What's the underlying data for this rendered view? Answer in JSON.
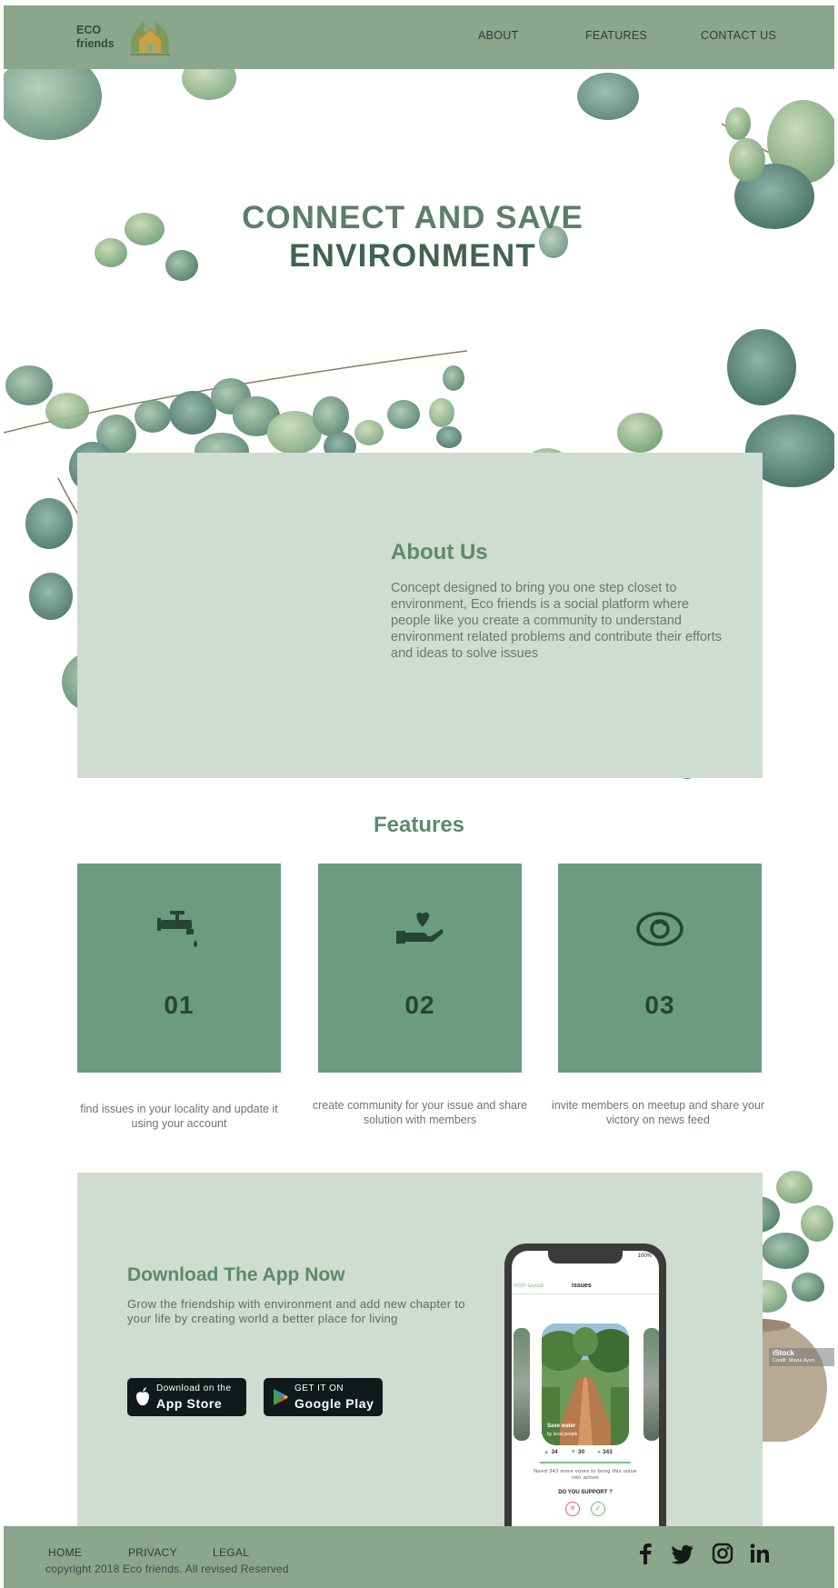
{
  "brand": {
    "line1": "ECO",
    "line2": "friends"
  },
  "nav": {
    "about": "ABOUT",
    "features": "FEATURES",
    "contact": "CONTACT US"
  },
  "hero": {
    "line1": "CONNECT AND SAVE",
    "line2": "ENVIRONMENT"
  },
  "about": {
    "title": "About Us",
    "text": "Concept designed to bring you one step closet to environment, Eco friends is a social platform where people like you create a community to understand environment related problems and contribute their efforts and ideas to solve issues"
  },
  "features": {
    "title": "Features",
    "items": [
      {
        "icon": "faucet-icon",
        "number": "01",
        "text": "find issues in your locality and update it using your account"
      },
      {
        "icon": "hand-heart-icon",
        "number": "02",
        "text": "create community for your issue and share solution with members"
      },
      {
        "icon": "eye-swirl-icon",
        "number": "03",
        "text": "invite members on meetup and share your victory on news feed"
      }
    ]
  },
  "download": {
    "title": "Download The App Now",
    "text": "Grow the friendship with environment and  add new chapter to your life by creating world  a better place for living",
    "apple": {
      "small": "Download  on the",
      "big": "App Store"
    },
    "google": {
      "small": "GET IT ON",
      "big": "Google Play"
    }
  },
  "phone": {
    "status": "100%",
    "back": "HSR layout",
    "title": "issues",
    "likes": "34",
    "dislikes": "30",
    "comments": "343",
    "need": "Need 343 more votes to bring this issue  into action",
    "support": "DO YOU SUPPORT ?",
    "card_caption": "Save water",
    "card_sub": "by local people"
  },
  "watermark": {
    "line1": "iStock",
    "line2": "Credit: Mayia Ayvn"
  },
  "footer": {
    "home": "HOME",
    "privacy": "PRIVACY",
    "legal": "LEGAL",
    "copyright": "copyright 2018 Eco friends. All revised Reserved"
  },
  "colors": {
    "header_bg": "#8aa68b",
    "panel_bg": "#cfdcd1",
    "card_bg": "#6b9b80",
    "title_green": "#5c8a6d",
    "store_btn": "#101a1a"
  }
}
